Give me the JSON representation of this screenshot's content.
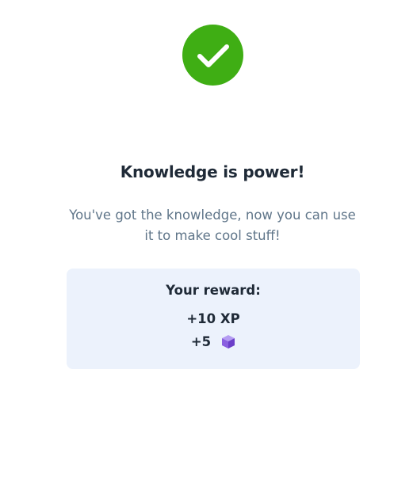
{
  "success": {
    "icon": "checkmark-circle-icon",
    "color": "#3fae14"
  },
  "title": "Knowledge is power!",
  "subtitle": "You've got the knowledge, now you can use it to make cool stuff!",
  "reward": {
    "heading": "Your reward:",
    "xp": "+10 XP",
    "gems": "+5",
    "gem_icon": "purple-cube-icon",
    "card_color": "#ecf2fc"
  }
}
